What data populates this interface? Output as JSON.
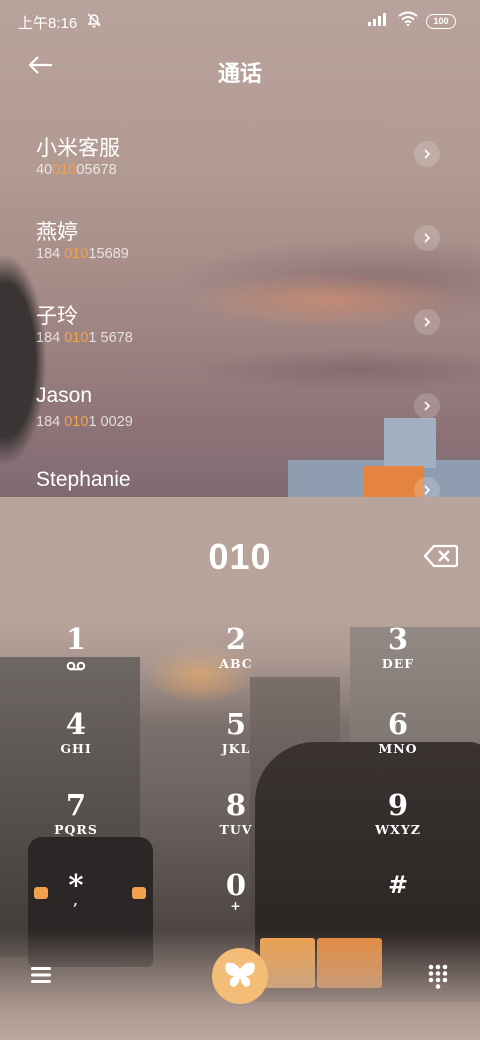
{
  "status_bar": {
    "time": "上午8:16",
    "battery": "100",
    "icons": [
      "mute-icon",
      "signal-icon",
      "wifi-icon",
      "battery-icon"
    ]
  },
  "header": {
    "title": "通话",
    "back_icon": "back-arrow-icon"
  },
  "contacts": [
    {
      "name": "小米客服",
      "number_parts": [
        "40",
        "010",
        "05678"
      ]
    },
    {
      "name": "燕婷",
      "number_parts": [
        "184 ",
        "010",
        "15689"
      ]
    },
    {
      "name": "子玲",
      "number_parts": [
        "184 ",
        "010",
        "1 5678"
      ]
    },
    {
      "name": "Jason",
      "number_parts": [
        "184 ",
        "010",
        "1 0029"
      ]
    },
    {
      "name": "Stephanie",
      "number_parts": [
        "",
        "",
        ""
      ]
    }
  ],
  "dial": {
    "input": "010",
    "backspace_icon": "backspace-icon"
  },
  "keypad": [
    {
      "digit": "1",
      "letters": ""
    },
    {
      "digit": "2",
      "letters": "ABC"
    },
    {
      "digit": "3",
      "letters": "DEF"
    },
    {
      "digit": "4",
      "letters": "GHI"
    },
    {
      "digit": "5",
      "letters": "JKL"
    },
    {
      "digit": "6",
      "letters": "MNO"
    },
    {
      "digit": "7",
      "letters": "PQRS"
    },
    {
      "digit": "8",
      "letters": "TUV"
    },
    {
      "digit": "9",
      "letters": "WXYZ"
    },
    {
      "digit": "*",
      "letters": ","
    },
    {
      "digit": "0",
      "letters": "+"
    },
    {
      "digit": "#",
      "letters": ""
    }
  ],
  "bottom_bar": {
    "menu_icon": "menu-icon",
    "call_icon": "butterfly-call-icon",
    "dialpad_icon": "dialpad-icon"
  },
  "colors": {
    "highlight": "#f0a24c",
    "call_button": "#f3bd77"
  }
}
